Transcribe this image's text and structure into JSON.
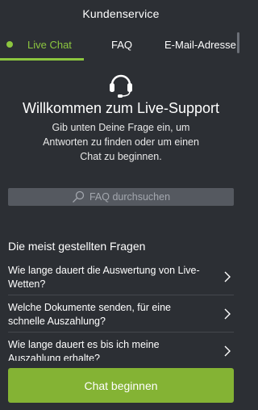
{
  "header": {
    "title": "Kundenservice"
  },
  "tabs": [
    {
      "label": "Live Chat",
      "active": true
    },
    {
      "label": "FAQ",
      "active": false
    },
    {
      "label": "E-Mail-Adresse",
      "active": false
    }
  ],
  "hero": {
    "icon": "headset-icon",
    "title": "Willkommen zum Live-Support",
    "subtitle_lines": [
      "Gib unten Deine Frage ein, um",
      "Antworten zu finden oder um einen",
      "Chat zu beginnen."
    ]
  },
  "search": {
    "placeholder": "FAQ durchsuchen",
    "icon": "search-icon"
  },
  "faq": {
    "title": "Die meist gestellten Fragen",
    "items": [
      {
        "lines": [
          "Wie lange dauert die Auswertung von Live-",
          "Wetten?"
        ]
      },
      {
        "lines": [
          "Welche Dokumente senden, für eine",
          "schnelle Auszahlung?"
        ]
      },
      {
        "lines": [
          "Wie lange dauert es bis ich meine",
          "Auszahlung erhalte?"
        ]
      }
    ]
  },
  "chat_button": {
    "label": "Chat beginnen"
  },
  "colors": {
    "background": "#2c2f34",
    "accent": "#8cc63f",
    "button": "#84b334",
    "search_bg": "#555960"
  }
}
